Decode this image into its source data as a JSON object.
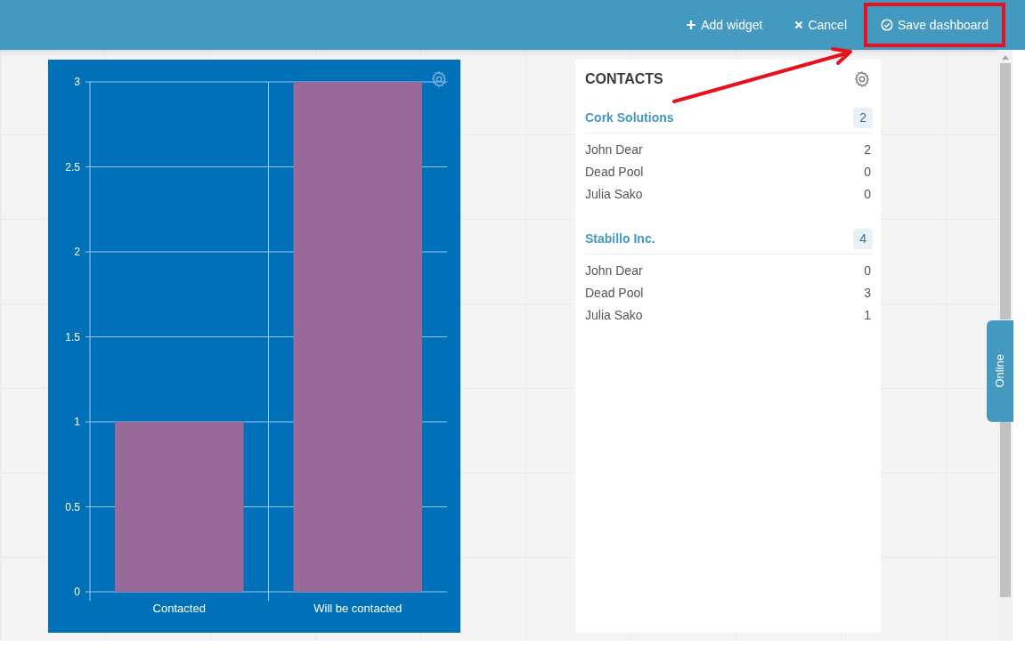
{
  "toolbar": {
    "buttons": [
      {
        "kind": "plus",
        "label": "Add widget",
        "highlighted": false
      },
      {
        "kind": "close",
        "label": "Cancel",
        "highlighted": false
      },
      {
        "kind": "check",
        "label": "Save dashboard",
        "highlighted": true
      }
    ]
  },
  "chart_widget": {
    "chart_data": {
      "type": "bar",
      "categories": [
        "Contacted",
        "Will be contacted"
      ],
      "values": [
        1,
        3
      ],
      "ylim": [
        0,
        3
      ],
      "yticks": [
        0,
        0.5,
        1,
        1.5,
        2,
        2.5,
        3
      ],
      "grid": true
    }
  },
  "contacts_widget": {
    "title": "CONTACTS",
    "groups": [
      {
        "name": "Cork Solutions",
        "count": "2",
        "contacts": [
          {
            "name": "John Dear",
            "count": "2"
          },
          {
            "name": "Dead Pool",
            "count": "0"
          },
          {
            "name": "Julia Sako",
            "count": "0"
          }
        ]
      },
      {
        "name": "Stabillo Inc.",
        "count": "4",
        "contacts": [
          {
            "name": "John Dear",
            "count": "0"
          },
          {
            "name": "Dead Pool",
            "count": "3"
          },
          {
            "name": "Julia Sako",
            "count": "1"
          }
        ]
      }
    ]
  },
  "side_tab": {
    "label": "Online"
  }
}
